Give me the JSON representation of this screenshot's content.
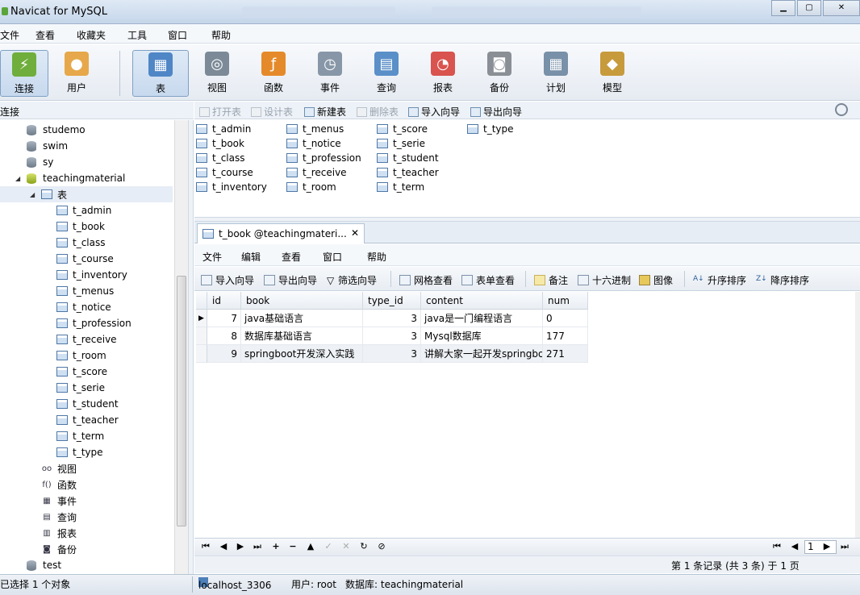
{
  "window": {
    "title": "Navicat for MySQL"
  },
  "menu": [
    "文件",
    "查看",
    "收藏夹",
    "工具",
    "窗口",
    "帮助"
  ],
  "toolbar": [
    {
      "label": "连接",
      "icon": "connection-icon",
      "color": "#6fae3c"
    },
    {
      "label": "用户",
      "icon": "user-icon",
      "color": "#e6a84a"
    },
    {
      "label": "表",
      "icon": "table-icon",
      "color": "#4f86c6"
    },
    {
      "label": "视图",
      "icon": "view-icon",
      "color": "#7c8a98"
    },
    {
      "label": "函数",
      "icon": "function-icon",
      "color": "#e58a2a"
    },
    {
      "label": "事件",
      "icon": "event-icon",
      "color": "#8797a8"
    },
    {
      "label": "查询",
      "icon": "query-icon",
      "color": "#5a8fc8"
    },
    {
      "label": "报表",
      "icon": "report-icon",
      "color": "#d9534f"
    },
    {
      "label": "备份",
      "icon": "backup-icon",
      "color": "#8a8f96"
    },
    {
      "label": "计划",
      "icon": "schedule-icon",
      "color": "#7890a8"
    },
    {
      "label": "模型",
      "icon": "model-icon",
      "color": "#c79a3c"
    }
  ],
  "sidebar": {
    "header": "连接",
    "items": [
      {
        "label": "studemo",
        "kind": "db"
      },
      {
        "label": "swim",
        "kind": "db"
      },
      {
        "label": "sy",
        "kind": "db"
      },
      {
        "label": "teachingmaterial",
        "kind": "db-open"
      },
      {
        "label": "表",
        "kind": "folder"
      },
      {
        "label": "t_admin",
        "kind": "table"
      },
      {
        "label": "t_book",
        "kind": "table"
      },
      {
        "label": "t_class",
        "kind": "table"
      },
      {
        "label": "t_course",
        "kind": "table"
      },
      {
        "label": "t_inventory",
        "kind": "table"
      },
      {
        "label": "t_menus",
        "kind": "table"
      },
      {
        "label": "t_notice",
        "kind": "table"
      },
      {
        "label": "t_profession",
        "kind": "table"
      },
      {
        "label": "t_receive",
        "kind": "table"
      },
      {
        "label": "t_room",
        "kind": "table"
      },
      {
        "label": "t_score",
        "kind": "table"
      },
      {
        "label": "t_serie",
        "kind": "table"
      },
      {
        "label": "t_student",
        "kind": "table"
      },
      {
        "label": "t_teacher",
        "kind": "table"
      },
      {
        "label": "t_term",
        "kind": "table"
      },
      {
        "label": "t_type",
        "kind": "table"
      },
      {
        "label": "视图",
        "kind": "sub",
        "icon": "view-icon",
        "glyph": "oo"
      },
      {
        "label": "函数",
        "kind": "sub",
        "icon": "function-icon",
        "glyph": "f()"
      },
      {
        "label": "事件",
        "kind": "sub",
        "icon": "event-icon",
        "glyph": "▦"
      },
      {
        "label": "查询",
        "kind": "sub",
        "icon": "query-icon",
        "glyph": "▤"
      },
      {
        "label": "报表",
        "kind": "sub",
        "icon": "report-icon",
        "glyph": "▥"
      },
      {
        "label": "备份",
        "kind": "sub",
        "icon": "backup-icon",
        "glyph": "◙"
      },
      {
        "label": "test",
        "kind": "db"
      }
    ]
  },
  "object_toolbar": [
    {
      "label": "打开表",
      "enabled": false
    },
    {
      "label": "设计表",
      "enabled": false
    },
    {
      "label": "新建表",
      "enabled": true
    },
    {
      "label": "删除表",
      "enabled": false
    },
    {
      "label": "导入向导",
      "enabled": true
    },
    {
      "label": "导出向导",
      "enabled": true
    }
  ],
  "object_list": [
    [
      "t_admin",
      "t_book",
      "t_class",
      "t_course",
      "t_inventory"
    ],
    [
      "t_menus",
      "t_notice",
      "t_profession",
      "t_receive",
      "t_room"
    ],
    [
      "t_score",
      "t_serie",
      "t_student",
      "t_teacher",
      "t_term"
    ],
    [
      "t_type"
    ]
  ],
  "tab": {
    "label": "t_book @teachingmateri...",
    "close": "✕"
  },
  "inner_menu": [
    "文件",
    "编辑",
    "查看",
    "窗口",
    "帮助"
  ],
  "inner_toolbar": [
    "导入向导",
    "导出向导",
    "筛选向导",
    "网格查看",
    "表单查看",
    "备注",
    "十六进制",
    "图像",
    "升序排序",
    "降序排序"
  ],
  "grid": {
    "columns": [
      "id",
      "book",
      "type_id",
      "content",
      "num"
    ],
    "rows": [
      [
        "7",
        "java基础语言",
        "3",
        "java是一门编程语言",
        "0"
      ],
      [
        "8",
        "数据库基础语言",
        "3",
        "Mysql数据库",
        "177"
      ],
      [
        "9",
        "springboot开发深入实践",
        "3",
        "讲解大家一起开发springbo",
        "271"
      ]
    ]
  },
  "pager": {
    "page": "1"
  },
  "record_status": "第 1 条记录 (共 3 条) 于 1 页",
  "status": {
    "selection": "已选择 1 个对象",
    "host": "localhost_3306",
    "user": "用户: root",
    "database": "数据库: teachingmaterial"
  }
}
